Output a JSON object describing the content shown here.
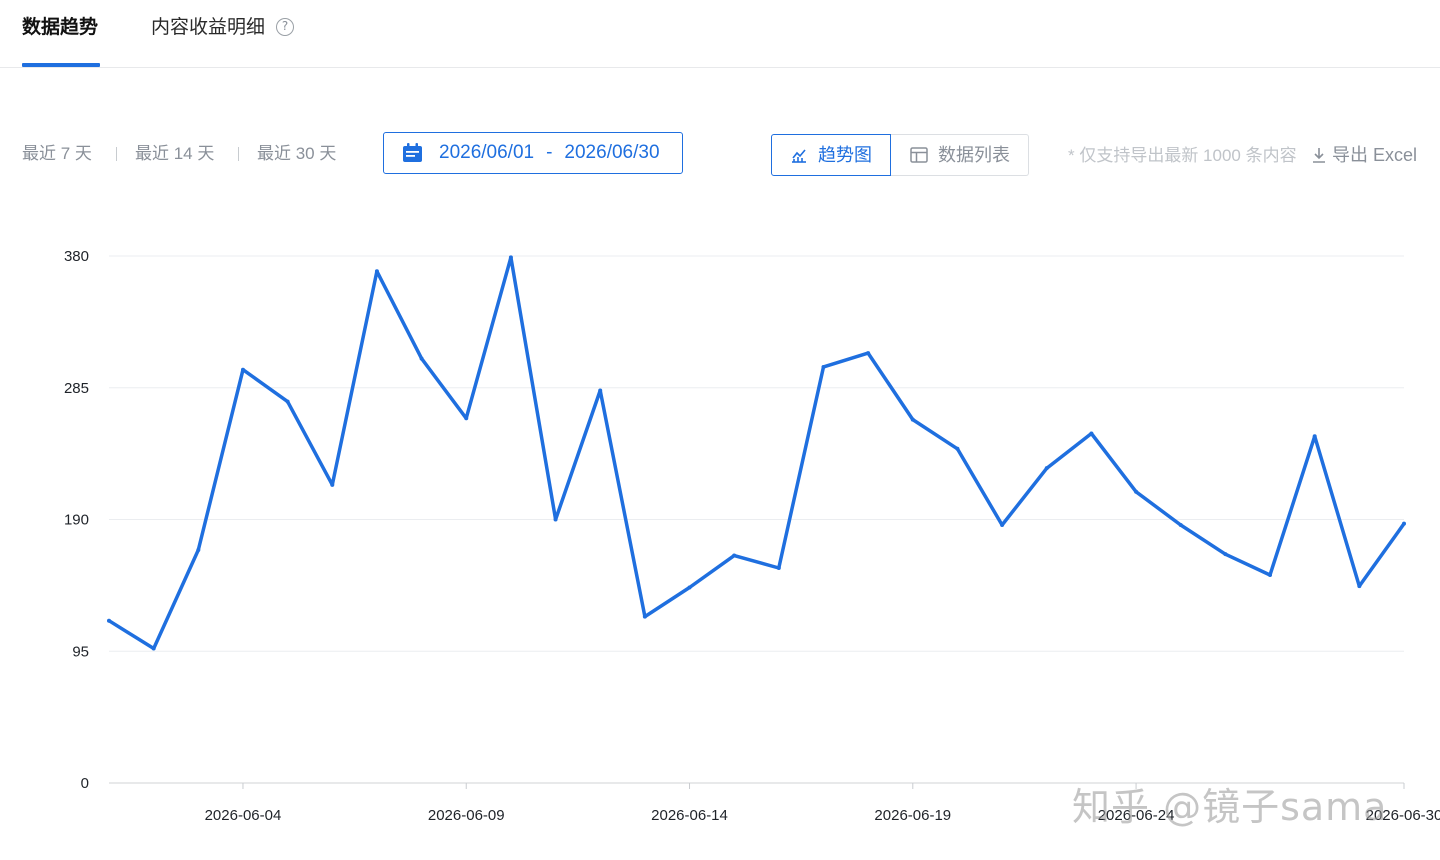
{
  "tabs": [
    {
      "label": "数据趋势",
      "active": true
    },
    {
      "label": "内容收益明细",
      "active": false
    }
  ],
  "help_icon": "question-circle-icon",
  "ranges": [
    "最近 7 天",
    "最近 14 天",
    "最近 30 天"
  ],
  "date_range": {
    "start": "2026/06/01",
    "separator": "-",
    "end": "2026/06/30",
    "icon": "calendar-icon"
  },
  "view_toggle": {
    "trend": {
      "label": "趋势图",
      "icon": "line-chart-icon",
      "selected": true
    },
    "table": {
      "label": "数据列表",
      "icon": "table-icon",
      "selected": false
    }
  },
  "export_note": "* 仅支持导出最新 1000 条内容",
  "export_label": "导出 Excel",
  "export_icon": "download-icon",
  "accent_color": "#1f6fdf",
  "watermark": "知乎 @镜子sama",
  "chart_data": {
    "type": "line",
    "x": [
      "2026-06-01",
      "2026-06-02",
      "2026-06-03",
      "2026-06-04",
      "2026-06-05",
      "2026-06-06",
      "2026-06-07",
      "2026-06-08",
      "2026-06-09",
      "2026-06-10",
      "2026-06-11",
      "2026-06-12",
      "2026-06-13",
      "2026-06-14",
      "2026-06-15",
      "2026-06-16",
      "2026-06-17",
      "2026-06-18",
      "2026-06-19",
      "2026-06-20",
      "2026-06-21",
      "2026-06-22",
      "2026-06-23",
      "2026-06-24",
      "2026-06-25",
      "2026-06-26",
      "2026-06-27",
      "2026-06-28",
      "2026-06-29",
      "2026-06-30"
    ],
    "series": [
      {
        "values": [
          117,
          97,
          168,
          298,
          275,
          215,
          369,
          306,
          263,
          379,
          190,
          283,
          120,
          141,
          164,
          155,
          300,
          310,
          262,
          241,
          186,
          227,
          252,
          210,
          186,
          165,
          150,
          250,
          142,
          187
        ],
        "color": "#1f6fdf"
      }
    ],
    "y_ticks": [
      0,
      95,
      190,
      285,
      380
    ],
    "x_tick_labels": [
      "2026-06-04",
      "2026-06-09",
      "2026-06-14",
      "2026-06-19",
      "2026-06-24",
      "2026-06-30"
    ],
    "ylim": [
      0,
      380
    ],
    "grid": "horizontal",
    "title": "",
    "xlabel": "",
    "ylabel": ""
  }
}
